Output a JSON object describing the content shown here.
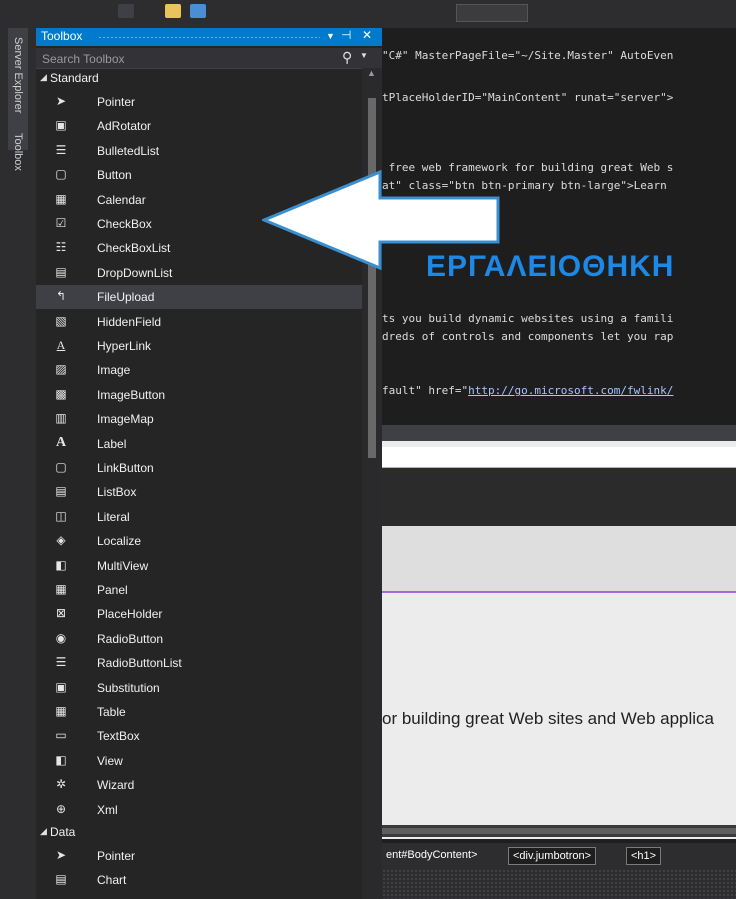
{
  "sidebar_tabs": [
    {
      "label": "Server Explorer"
    },
    {
      "label": "Toolbox"
    }
  ],
  "toolbox": {
    "title": "Toolbox",
    "search_placeholder": "Search Toolbox",
    "groups": [
      {
        "name": "Standard",
        "items": [
          {
            "label": "Pointer",
            "icon": "pointer-icon"
          },
          {
            "label": "AdRotator",
            "icon": "adrotator-icon"
          },
          {
            "label": "BulletedList",
            "icon": "bulletedlist-icon"
          },
          {
            "label": "Button",
            "icon": "button-icon"
          },
          {
            "label": "Calendar",
            "icon": "calendar-icon"
          },
          {
            "label": "CheckBox",
            "icon": "checkbox-icon"
          },
          {
            "label": "CheckBoxList",
            "icon": "checkboxlist-icon"
          },
          {
            "label": "DropDownList",
            "icon": "dropdownlist-icon"
          },
          {
            "label": "FileUpload",
            "icon": "fileupload-icon",
            "selected": true
          },
          {
            "label": "HiddenField",
            "icon": "hiddenfield-icon"
          },
          {
            "label": "HyperLink",
            "icon": "hyperlink-icon"
          },
          {
            "label": "Image",
            "icon": "image-icon"
          },
          {
            "label": "ImageButton",
            "icon": "imagebutton-icon"
          },
          {
            "label": "ImageMap",
            "icon": "imagemap-icon"
          },
          {
            "label": "Label",
            "icon": "label-icon"
          },
          {
            "label": "LinkButton",
            "icon": "linkbutton-icon"
          },
          {
            "label": "ListBox",
            "icon": "listbox-icon"
          },
          {
            "label": "Literal",
            "icon": "literal-icon"
          },
          {
            "label": "Localize",
            "icon": "localize-icon"
          },
          {
            "label": "MultiView",
            "icon": "multiview-icon"
          },
          {
            "label": "Panel",
            "icon": "panel-icon"
          },
          {
            "label": "PlaceHolder",
            "icon": "placeholder-icon"
          },
          {
            "label": "RadioButton",
            "icon": "radiobutton-icon"
          },
          {
            "label": "RadioButtonList",
            "icon": "radiobuttonlist-icon"
          },
          {
            "label": "Substitution",
            "icon": "substitution-icon"
          },
          {
            "label": "Table",
            "icon": "table-icon"
          },
          {
            "label": "TextBox",
            "icon": "textbox-icon"
          },
          {
            "label": "View",
            "icon": "view-icon"
          },
          {
            "label": "Wizard",
            "icon": "wizard-icon"
          },
          {
            "label": "Xml",
            "icon": "xml-icon"
          }
        ]
      },
      {
        "name": "Data",
        "items": [
          {
            "label": "Pointer",
            "icon": "pointer-icon"
          },
          {
            "label": "Chart",
            "icon": "chart-icon"
          }
        ]
      }
    ]
  },
  "editor": {
    "code_lines": {
      "l1": "\"C#\" MasterPageFile=\"~/Site.Master\" AutoEven",
      "l2": "tPlaceHolderID=\"MainContent\" runat=\"server\">",
      "l3": " free web framework for building great Web s",
      "l4": "at\" class=\"btn btn-primary btn-large\">Learn",
      "l5": "ts you build dynamic websites using a famili",
      "l6": "dreds of controls and components let you rap",
      "l7_prefix": "fault\" href=\"",
      "l7_link": "http://go.microsoft.com/fwlink/"
    },
    "overlay_title": "ΕΡΓΑΛΕΙΟΘΗΚΗ",
    "design_text": "or building great Web sites and Web applica",
    "breadcrumb": [
      "ent#BodyContent>",
      "<div.jumbotron>",
      "<h1>"
    ]
  },
  "colors": {
    "accent": "#007acc",
    "overlay_title": "#1e88e5",
    "selection_bg": "#3f3f46"
  }
}
